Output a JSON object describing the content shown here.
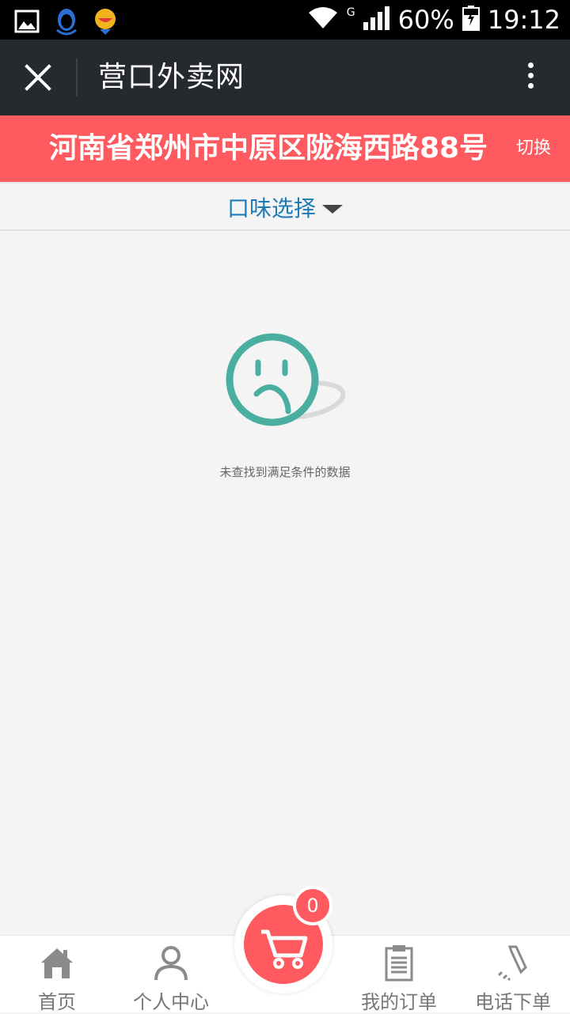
{
  "status_bar": {
    "signal": "G",
    "battery": "60%",
    "time": "19:12",
    "icons": [
      "gallery-icon",
      "qq-icon",
      "emoji-icon",
      "wifi-icon",
      "cellular-icon",
      "battery-charging-icon"
    ]
  },
  "title_bar": {
    "title": "营口外卖网"
  },
  "address_bar": {
    "address": "河南省郑州市中原区陇海西路88号",
    "switch_label": "切换"
  },
  "filter": {
    "label": "口味选择"
  },
  "empty_state": {
    "message": "未查找到满足条件的数据"
  },
  "bottom_nav": {
    "items": [
      {
        "label": "首页",
        "icon": "home-icon"
      },
      {
        "label": "个人中心",
        "icon": "user-icon"
      },
      {
        "label": "我的订单",
        "icon": "clipboard-icon"
      },
      {
        "label": "电话下单",
        "icon": "phone-icon"
      }
    ],
    "cart_count": "0"
  },
  "colors": {
    "accent": "#ff5a5f",
    "title_bar": "#262a2e",
    "filter_text": "#1f7ab8",
    "empty_icon": "#4aaea0"
  }
}
